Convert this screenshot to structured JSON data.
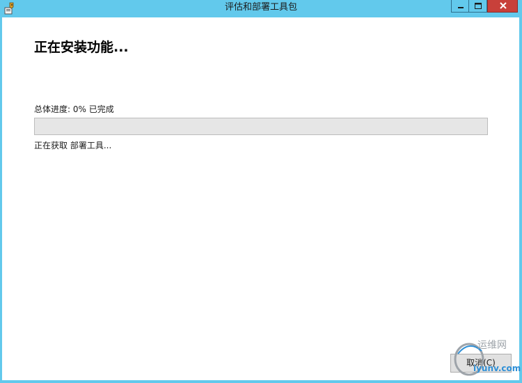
{
  "window": {
    "title": "评估和部署工具包",
    "app_icon": "setup-icon",
    "controls": {
      "minimize_icon": "minimize-icon",
      "maximize_icon": "maximize-icon",
      "close_icon": "close-icon"
    }
  },
  "main": {
    "heading": "正在安装功能...",
    "progress": {
      "label": "总体进度: 0% 已完成",
      "value": 0
    },
    "status": "正在获取 部署工具..."
  },
  "footer": {
    "cancel_label": "取消(C)"
  },
  "watermark": {
    "top_text": "运维网",
    "bottom_text": "iyunv.com"
  },
  "colors": {
    "chrome": "#62c9ec",
    "close": "#c8403a",
    "content_bg": "#ffffff",
    "progress_track": "#e6e6e6",
    "watermark_blue": "#2e8fd6"
  }
}
